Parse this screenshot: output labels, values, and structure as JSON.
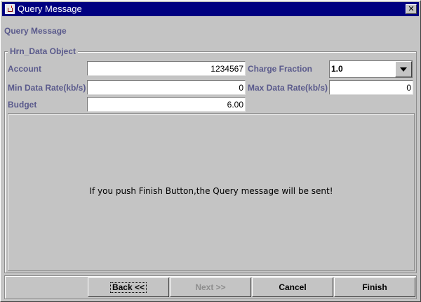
{
  "window": {
    "title": "Query Message",
    "close_glyph": "✕"
  },
  "heading": "Query Message",
  "group": {
    "legend": "Hrn_Data Object",
    "account_label": "Account",
    "account_value": "1234567",
    "charge_fraction_label": "Charge Fraction",
    "charge_fraction_value": "1.0",
    "min_rate_label": "Min Data Rate(kb/s)",
    "min_rate_value": "0",
    "max_rate_label": "Max Data Rate(kb/s)",
    "max_rate_value": "0",
    "budget_label": "Budget",
    "budget_value": "6.00"
  },
  "message": "If you push Finish Button,the Query message will be sent!",
  "buttons": {
    "back": "Back <<",
    "next": "Next >>",
    "cancel": "Cancel",
    "finish": "Finish"
  },
  "colors": {
    "titlebar": "#000080",
    "label": "#5a5a8c",
    "background": "#c4c4c4"
  }
}
